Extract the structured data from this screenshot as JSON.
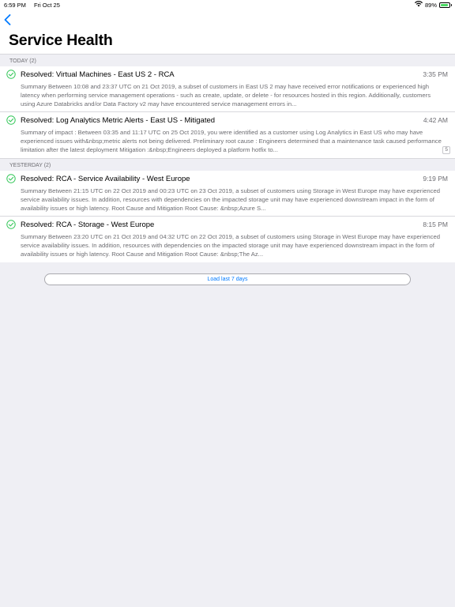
{
  "status_bar": {
    "time": "6:59 PM",
    "date": "Fri Oct 25",
    "battery": "89%",
    "battery_level": 0.89,
    "icons": [
      "wifi-icon",
      "battery-icon"
    ]
  },
  "nav": {
    "back_icon": "chevron-left-icon",
    "title": "Service Health"
  },
  "colors": {
    "accent": "#007aff",
    "success": "#34c759",
    "secondary_text": "#6d6d72",
    "background": "#efeff4"
  },
  "sections": [
    {
      "header": "TODAY (2)",
      "items": [
        {
          "icon": "check-circle-icon",
          "title": "Resolved: Virtual Machines - East US 2 - RCA",
          "time": "3:35 PM",
          "summary": "Summary Between 10:08 and 23:37 UTC on 21 Oct 2019, a subset of customers in East US 2 may have received error notifications or experienced high latency when performing service management operations - such as create, update, or delete - for resources hosted in this region. Additionally, customers using Azure Databricks and/or Data Factory v2 may have encountered service management errors in...",
          "badge": ""
        },
        {
          "icon": "check-circle-icon",
          "title": "Resolved: Log Analytics Metric Alerts - East US - Mitigated",
          "time": "4:42 AM",
          "summary": "Summary of impact : Between 03:35 and 11:17 UTC on 25 Oct 2019, you were identified as a customer using Log Analytics in East US who may have experienced issues with&nbsp;metric alerts not being delivered. Preliminary root cause : Engineers determined that a maintenance task caused performance limitation after the latest deployment Mitigation :&nbsp;Engineers deployed a platform hotfix to...",
          "badge": "5"
        }
      ]
    },
    {
      "header": "YESTERDAY (2)",
      "items": [
        {
          "icon": "check-circle-icon",
          "title": "Resolved: RCA - Service Availability - West Europe",
          "time": "9:19 PM",
          "summary": "Summary Between 21:15 UTC on 22 Oct 2019 and 00:23 UTC on 23 Oct 2019, a subset of customers using Storage in West Europe may have experienced service availability issues. In addition, resources with dependencies on the impacted storage unit may have experienced downstream impact in the form of availability issues or high latency. Root Cause and Mitigation Root Cause: &nbsp;Azure S...",
          "badge": ""
        },
        {
          "icon": "check-circle-icon",
          "title": "Resolved: RCA - Storage - West Europe",
          "time": "8:15 PM",
          "summary": "Summary Between 23:20 UTC on 21 Oct 2019 and 04:32 UTC on 22 Oct 2019, a subset of customers using Storage in West Europe may have experienced service availability issues. In addition, resources with dependencies on the impacted storage unit may have experienced downstream impact in the form of availability issues or high latency. Root Cause and Mitigation Root Cause: &nbsp;The Az...",
          "badge": ""
        }
      ]
    }
  ],
  "load_more": {
    "label": "Load last 7 days"
  }
}
